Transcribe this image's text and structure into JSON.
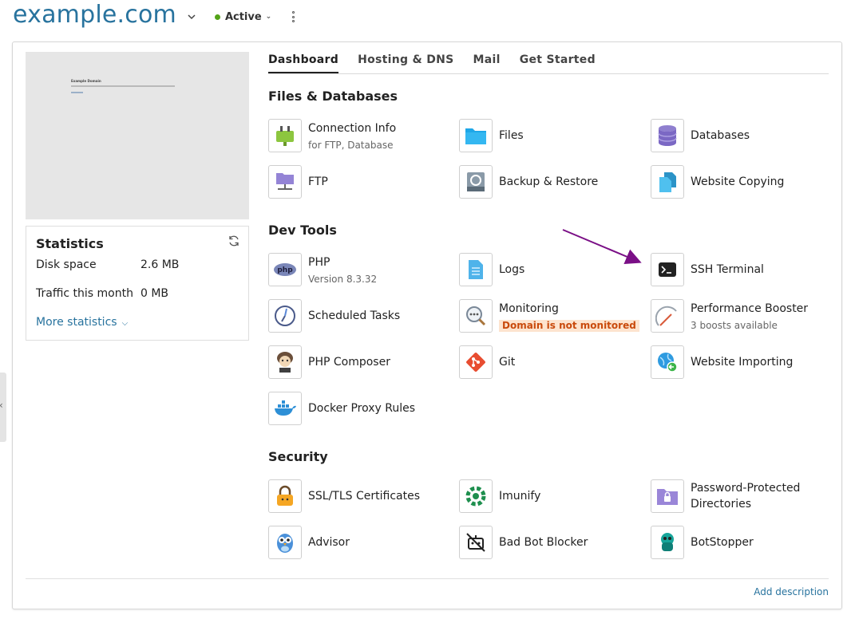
{
  "header": {
    "domain": "example.com",
    "status": "Active"
  },
  "preview": {
    "site_title": "Example Domain"
  },
  "stats": {
    "title": "Statistics",
    "rows": [
      {
        "label": "Disk space",
        "value": "2.6 MB"
      },
      {
        "label": "Traffic this month",
        "value": "0 MB"
      }
    ],
    "more": "More statistics"
  },
  "tabs": [
    "Dashboard",
    "Hosting & DNS",
    "Mail",
    "Get Started"
  ],
  "sections": {
    "files": "Files & Databases",
    "dev": "Dev Tools",
    "security": "Security"
  },
  "tools": {
    "connection_info": {
      "name": "Connection Info",
      "sub": "for FTP, Database",
      "icon": "plug-icon"
    },
    "files": {
      "name": "Files",
      "icon": "folder-icon"
    },
    "databases": {
      "name": "Databases",
      "icon": "database-icon"
    },
    "ftp": {
      "name": "FTP",
      "icon": "ftp-folder-icon"
    },
    "backup": {
      "name": "Backup & Restore",
      "icon": "backup-drive-icon"
    },
    "website_copying": {
      "name": "Website Copying",
      "icon": "copy-documents-icon"
    },
    "php": {
      "name": "PHP",
      "sub": "Version 8.3.32",
      "icon": "php-icon"
    },
    "logs": {
      "name": "Logs",
      "icon": "log-document-icon"
    },
    "ssh": {
      "name": "SSH Terminal",
      "icon": "terminal-icon"
    },
    "scheduled": {
      "name": "Scheduled Tasks",
      "icon": "clock-icon"
    },
    "monitoring": {
      "name": "Monitoring",
      "warn": "Domain is not monitored",
      "icon": "magnifier-icon"
    },
    "perf": {
      "name": "Performance Booster",
      "sub": "3 boosts available",
      "icon": "speedometer-icon"
    },
    "composer": {
      "name": "PHP Composer",
      "icon": "composer-conductor-icon"
    },
    "git": {
      "name": "Git",
      "icon": "git-icon"
    },
    "importing": {
      "name": "Website Importing",
      "icon": "globe-import-icon"
    },
    "docker": {
      "name": "Docker Proxy Rules",
      "icon": "docker-whale-icon"
    },
    "ssl": {
      "name": "SSL/TLS Certificates",
      "icon": "padlock-icon"
    },
    "imunify": {
      "name": "Imunify",
      "icon": "imunify-shield-icon"
    },
    "pwdirs": {
      "name": "Password-Protected Directories",
      "icon": "locked-folder-icon"
    },
    "advisor": {
      "name": "Advisor",
      "icon": "owl-icon"
    },
    "badbot": {
      "name": "Bad Bot Blocker",
      "icon": "robot-blocked-icon"
    },
    "botstopper": {
      "name": "BotStopper",
      "icon": "bot-stopper-icon"
    }
  },
  "footer": {
    "add_description": "Add description"
  },
  "colors": {
    "link": "#28739e",
    "active": "#53a318",
    "annotation_arrow": "#7a0f86"
  }
}
